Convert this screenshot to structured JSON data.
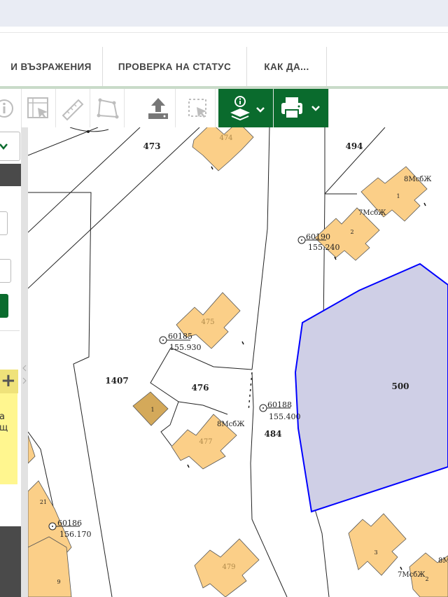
{
  "nav": {
    "tabs": [
      {
        "label": "И ВЪЗРАЖЕНИЯ"
      },
      {
        "label": "ПРОВЕРКА НА СТАТУС"
      },
      {
        "label": "КАК ДА..."
      }
    ]
  },
  "toolbar": {
    "tools": [
      {
        "icon": "info-icon"
      },
      {
        "icon": "select-feature-icon"
      },
      {
        "icon": "ruler-icon"
      },
      {
        "icon": "polygon-measure-icon"
      },
      {
        "icon": "upload-icon"
      },
      {
        "icon": "select-area-icon"
      },
      {
        "icon": "layer-info-dropdown-icon"
      },
      {
        "icon": "print-dropdown-icon"
      }
    ],
    "accent": "#0a6b2d"
  },
  "sidebar": {
    "button_text": "+",
    "note_lines": [
      "а",
      "щ"
    ]
  },
  "map": {
    "parcel_numbers": [
      "473",
      "494",
      "1407",
      "476",
      "484",
      "500"
    ],
    "building_labels": [
      "474",
      "475",
      "477",
      "479",
      "1",
      "2",
      "3",
      "9",
      "21",
      "1",
      "2"
    ],
    "building_codes": [
      "8МсбЖ",
      "7МсбЖ",
      "8МсбЖ",
      "7МсбЖ",
      "8М"
    ],
    "survey_points": [
      {
        "id": "60190",
        "elev": "155.240"
      },
      {
        "id": "60185",
        "elev": "155.930"
      },
      {
        "id": "60188",
        "elev": "155.400"
      },
      {
        "id": "60186",
        "elev": "156.170"
      }
    ],
    "colors": {
      "building": "#fbcf88",
      "building_dark": "#d4a95a",
      "selection_fill": "#cfcfe6",
      "selection_stroke": "#0000ff"
    }
  }
}
